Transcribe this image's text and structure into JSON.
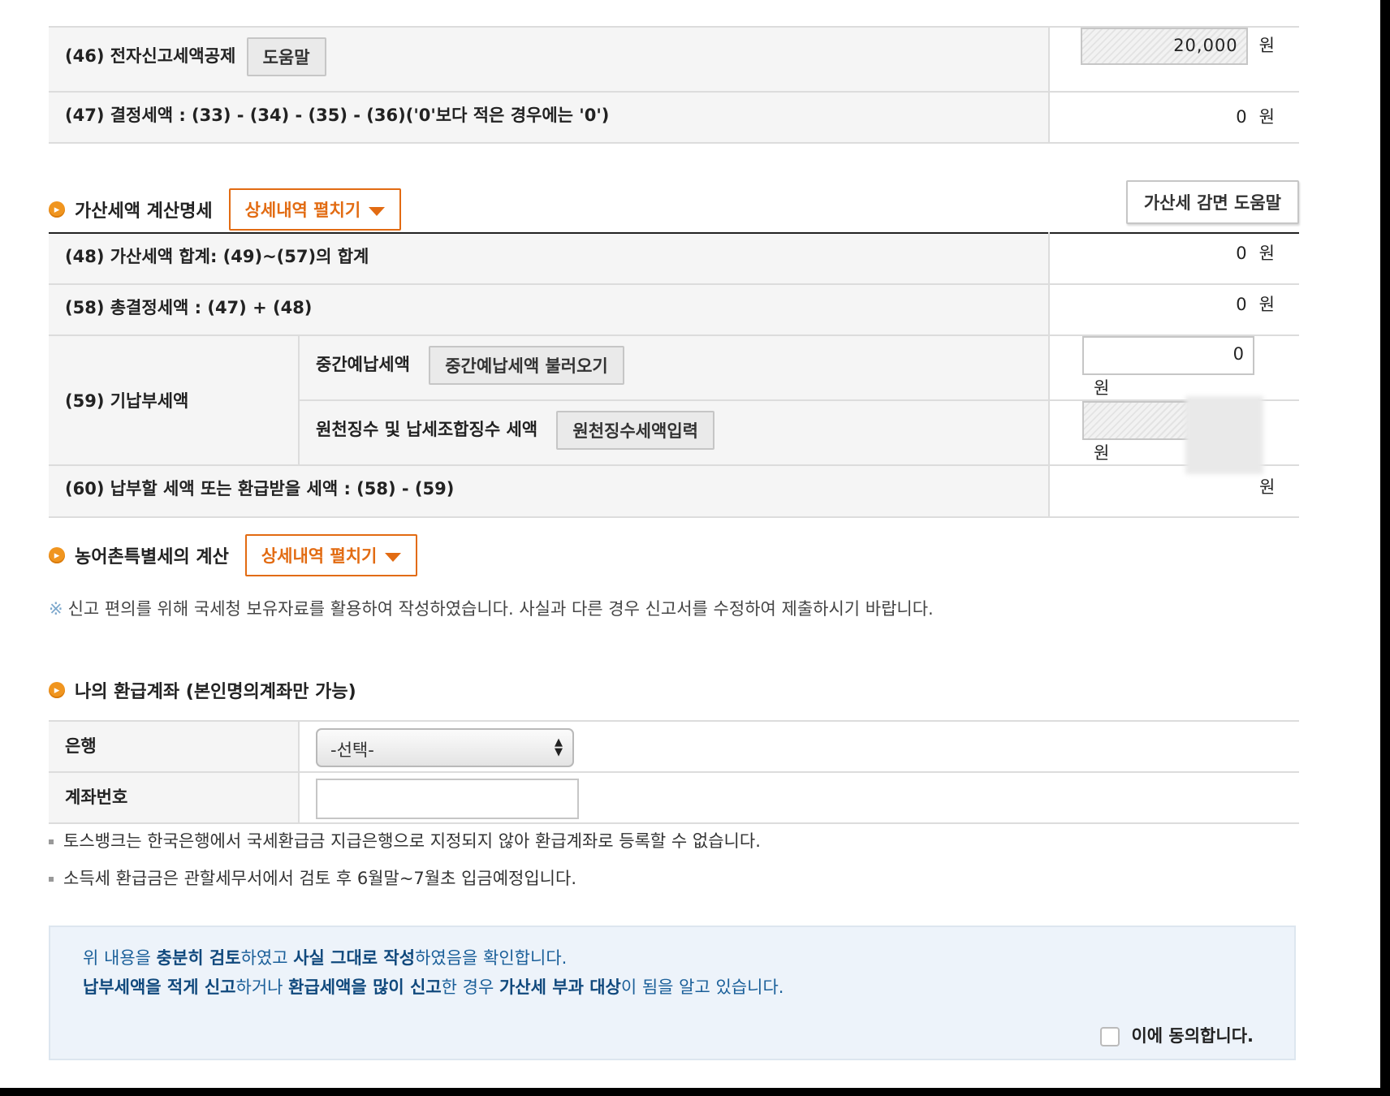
{
  "rows_top": [
    {
      "label": "(46) 전자신고세액공제",
      "button": "도움말",
      "amount": "20,000",
      "unit": "원"
    },
    {
      "label": "(47) 결정세액 : (33) - (34) - (35) - (36)('0'보다 적은 경우에는 '0')",
      "amount": "0",
      "unit": "원"
    }
  ],
  "penalty": {
    "title": "가산세액 계산명세",
    "expand_label": "상세내역 펼치기",
    "help_button": "가산세 감면 도움말",
    "rows": [
      {
        "label": "(48) 가산세액 합계: (49)~(57)의 합계",
        "amount": "0",
        "unit": "원"
      },
      {
        "label": "(58) 총결정세액 : (47) + (48)",
        "amount": "0",
        "unit": "원"
      }
    ],
    "prepaid": {
      "label": "(59) 기납부세액",
      "interim_label": "중간예납세액",
      "interim_button": "중간예납세액 불러오기",
      "interim_value": "0",
      "withholding_label": "원천징수 및 납세조합징수 세액",
      "withholding_button": "원천징수세액입력",
      "unit": "원"
    },
    "payable": {
      "label": "(60) 납부할 세액 또는 환급받을 세액 : (58) - (59)",
      "unit": "원"
    }
  },
  "rural": {
    "title": "농어촌특별세의 계산",
    "expand_label": "상세내역 펼치기",
    "notice_mark": "※",
    "notice": "신고 편의를 위해 국세청 보유자료를 활용하여 작성하였습니다. 사실과 다른 경우 신고서를 수정하여 제출하시기 바랍니다."
  },
  "refund": {
    "title": "나의 환급계좌 (본인명의계좌만 가능)",
    "bank_label": "은행",
    "bank_selected": "-선택-",
    "account_label": "계좌번호",
    "account_value": "",
    "notes": [
      "토스뱅크는 한국은행에서 국세환급금 지급은행으로 지정되지 않아 환급계좌로 등록할 수 없습니다.",
      "소득세 환급금은 관할세무서에서 검토 후 6월말~7월초 입금예정입니다."
    ]
  },
  "confirm": {
    "line1": [
      {
        "t": "위 내용을 ",
        "b": false
      },
      {
        "t": "충분히 검토",
        "b": true
      },
      {
        "t": "하였고 ",
        "b": false
      },
      {
        "t": "사실 그대로 작성",
        "b": true
      },
      {
        "t": "하였음을 확인합니다.",
        "b": false
      }
    ],
    "line2": [
      {
        "t": "납부세액을 적게 신고",
        "b": true
      },
      {
        "t": "하거나 ",
        "b": false
      },
      {
        "t": "환급세액을 많이 신고",
        "b": true
      },
      {
        "t": "한 경우 ",
        "b": false
      },
      {
        "t": "가산세 부과 대상",
        "b": true
      },
      {
        "t": "이 됨을 알고 있습니다.",
        "b": false
      }
    ],
    "agree_label": "이에 동의합니다."
  },
  "colors": {
    "accent": "#e26b12",
    "confirm_bg": "#edf3fa",
    "confirm_text": "#1a5f99"
  }
}
